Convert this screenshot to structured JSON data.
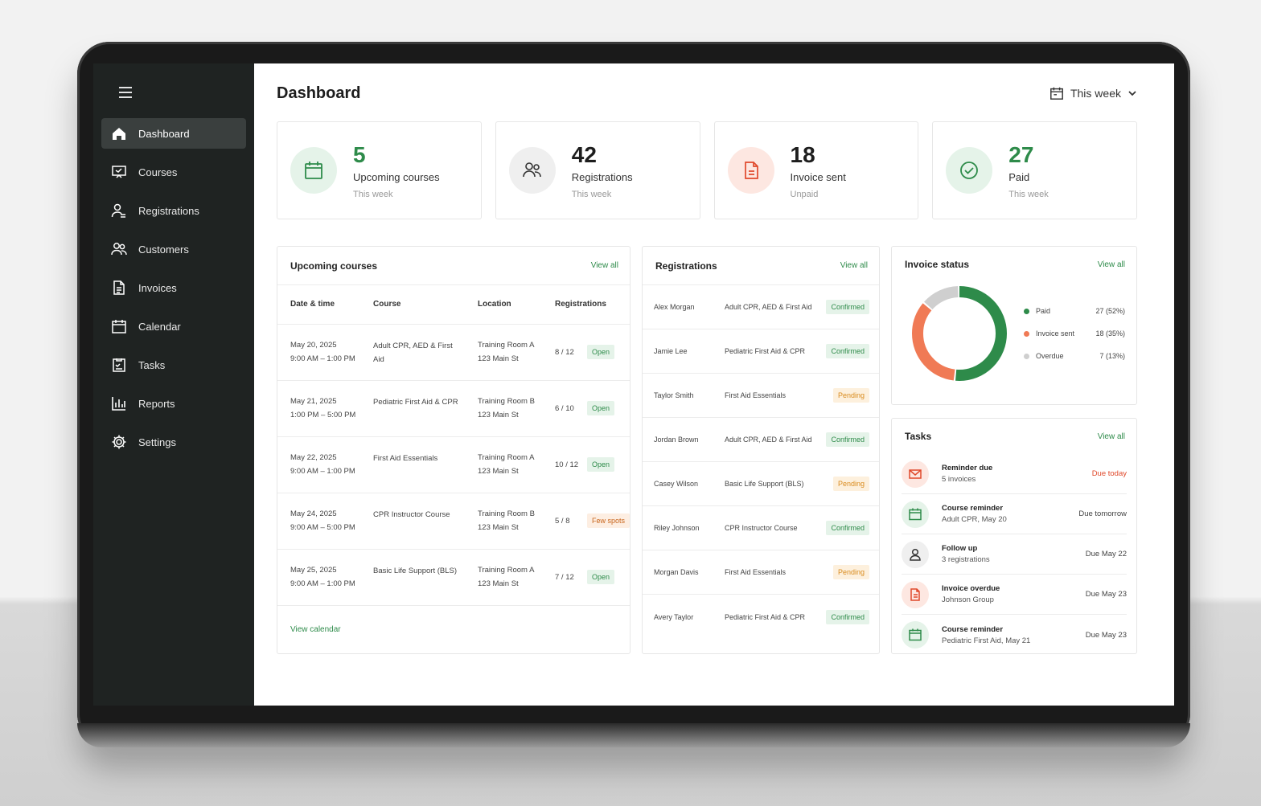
{
  "nav": {
    "items": [
      {
        "label": "Dashboard"
      },
      {
        "label": "Courses"
      },
      {
        "label": "Registrations"
      },
      {
        "label": "Customers"
      },
      {
        "label": "Invoices"
      },
      {
        "label": "Calendar"
      },
      {
        "label": "Tasks"
      },
      {
        "label": "Reports"
      },
      {
        "label": "Settings"
      }
    ]
  },
  "header": {
    "title": "Dashboard",
    "period": "This week"
  },
  "stats": [
    {
      "value": "5",
      "label": "Upcoming courses",
      "sub": "This week",
      "color": "#2e8b4a"
    },
    {
      "value": "42",
      "label": "Registrations",
      "sub": "This week",
      "color": "#1d1d1d"
    },
    {
      "value": "18",
      "label": "Invoice sent",
      "sub": "Unpaid",
      "color": "#1d1d1d"
    },
    {
      "value": "27",
      "label": "Paid",
      "sub": "This week",
      "color": "#2e8b4a"
    }
  ],
  "courses": {
    "title": "Upcoming courses",
    "view_all": "View all",
    "columns": [
      "Date & time",
      "Course",
      "Location",
      "Registrations"
    ],
    "rows": [
      {
        "date": "May 20, 2025",
        "time": "9:00 AM – 1:00 PM",
        "course": "Adult CPR, AED & First Aid",
        "room": "Training Room A",
        "address": "123 Main St",
        "count": "8 / 12",
        "status": "Open"
      },
      {
        "date": "May 21, 2025",
        "time": "1:00 PM – 5:00 PM",
        "course": "Pediatric First Aid & CPR",
        "room": "Training Room B",
        "address": "123 Main St",
        "count": "6 / 10",
        "status": "Open"
      },
      {
        "date": "May 22, 2025",
        "time": "9:00 AM – 1:00 PM",
        "course": "First Aid Essentials",
        "room": "Training Room A",
        "address": "123 Main St",
        "count": "10 / 12",
        "status": "Open"
      },
      {
        "date": "May 24, 2025",
        "time": "9:00 AM – 5:00 PM",
        "course": "CPR Instructor Course",
        "room": "Training Room B",
        "address": "123 Main St",
        "count": "5 / 8",
        "status": "Few spots"
      },
      {
        "date": "May 25, 2025",
        "time": "9:00 AM – 1:00 PM",
        "course": "Basic Life Support (BLS)",
        "room": "Training Room A",
        "address": "123 Main St",
        "count": "7 / 12",
        "status": "Open"
      }
    ],
    "footer_link": "View calendar"
  },
  "registrations": {
    "title": "Registrations",
    "view_all": "View all",
    "rows": [
      {
        "name": "Alex Morgan",
        "course": "Adult CPR, AED & First Aid",
        "status": "Confirmed"
      },
      {
        "name": "Jamie Lee",
        "course": "Pediatric First Aid & CPR",
        "status": "Confirmed"
      },
      {
        "name": "Taylor Smith",
        "course": "First Aid Essentials",
        "status": "Pending"
      },
      {
        "name": "Jordan Brown",
        "course": "Adult CPR, AED & First Aid",
        "status": "Confirmed"
      },
      {
        "name": "Casey Wilson",
        "course": "Basic Life Support (BLS)",
        "status": "Pending"
      },
      {
        "name": "Riley Johnson",
        "course": "CPR Instructor Course",
        "status": "Confirmed"
      },
      {
        "name": "Morgan Davis",
        "course": "First Aid Essentials",
        "status": "Pending"
      },
      {
        "name": "Avery Taylor",
        "course": "Pediatric First Aid & CPR",
        "status": "Confirmed"
      }
    ]
  },
  "invoice_status": {
    "title": "Invoice status",
    "view_all": "View all",
    "segments": [
      {
        "name": "Paid",
        "value": "27 (52%)",
        "count": 27,
        "color": "#2e8b4a"
      },
      {
        "name": "Invoice sent",
        "value": "18 (35%)",
        "count": 18,
        "color": "#f07a55"
      },
      {
        "name": "Overdue",
        "value": "7 (13%)",
        "count": 7,
        "color": "#cfcfcf"
      }
    ]
  },
  "tasks": {
    "title": "Tasks",
    "view_all": "View all",
    "items": [
      {
        "icon": "mail-icon",
        "title": "Reminder due",
        "sub": "5 invoices",
        "due": "Due today",
        "urgent": true
      },
      {
        "icon": "calendar-icon",
        "title": "Course reminder",
        "sub": "Adult CPR, May 20",
        "due": "Due tomorrow",
        "urgent": false
      },
      {
        "icon": "user-icon",
        "title": "Follow up",
        "sub": "3 registrations",
        "due": "Due May 22",
        "urgent": false
      },
      {
        "icon": "document-icon",
        "title": "Invoice overdue",
        "sub": "Johnson Group",
        "due": "Due May 23",
        "urgent": false
      },
      {
        "icon": "calendar-icon",
        "title": "Course reminder",
        "sub": "Pediatric First Aid, May 21",
        "due": "Due May 23",
        "urgent": false
      }
    ]
  }
}
